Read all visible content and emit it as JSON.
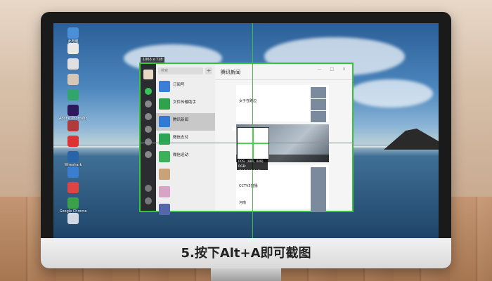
{
  "caption": "5.按下Alt+A即可截图",
  "desktop_icons": [
    {
      "label": "此电脑",
      "icon": "computer-icon",
      "color": "#4a8fd8"
    },
    {
      "label": "",
      "icon": "document-icon",
      "color": "#e8e8e8"
    },
    {
      "label": "",
      "icon": "document-icon",
      "color": "#e0e0e0"
    },
    {
      "label": "",
      "icon": "avatar-icon",
      "color": "#d6c6b7"
    },
    {
      "label": "",
      "icon": "app-icon",
      "color": "#31a56b"
    },
    {
      "label": "Adobe Photoshop",
      "icon": "photoshop-icon",
      "color": "#2d1a5c"
    },
    {
      "label": "",
      "icon": "app-icon",
      "color": "#b33a3a"
    },
    {
      "label": "",
      "icon": "app-icon",
      "color": "#d33"
    },
    {
      "label": "Wireshark",
      "icon": "wireshark-icon",
      "color": "#2a64a8"
    },
    {
      "label": "",
      "icon": "app-icon",
      "color": "#3a7ecf"
    },
    {
      "label": "",
      "icon": "app-icon",
      "color": "#d44"
    },
    {
      "label": "Google Chrome",
      "icon": "chrome-icon",
      "color": "#3aa14a"
    },
    {
      "label": "",
      "icon": "recycle-bin-icon",
      "color": "#cfd8e3"
    }
  ],
  "size_tip": "1063 x 718",
  "wechat": {
    "search_placeholder": "搜索",
    "add_label": "+",
    "chats": [
      {
        "name": "订阅号",
        "sub": "",
        "time": "",
        "color": "#3b7ed8"
      },
      {
        "name": "文件传输助手",
        "sub": "",
        "time": "",
        "color": "#2fa24b"
      },
      {
        "name": "腾讯新闻",
        "sub": "",
        "time": "",
        "color": "#2f7bd6",
        "active": true
      },
      {
        "name": "微信支付",
        "sub": "",
        "time": "",
        "color": "#2aa551"
      },
      {
        "name": "微信运动",
        "sub": "",
        "time": "",
        "color": "#3bb25a"
      },
      {
        "name": "",
        "sub": "",
        "time": "",
        "color": "#c8a37a"
      },
      {
        "name": "",
        "sub": "",
        "time": "",
        "color": "#d8a4c5"
      },
      {
        "name": "",
        "sub": "",
        "time": "",
        "color": "#5566aa"
      }
    ],
    "main_title": "腾讯新闻",
    "window_buttons": "— □ ×",
    "news": [
      "",
      "女子在路边",
      "",
      "",
      "",
      "CCTV5直播",
      "",
      "河南"
    ],
    "hero_caption": ""
  },
  "magnifier": {
    "pos": "POS: (881, 448)",
    "rgb": "RGB: (245,245,245)"
  }
}
